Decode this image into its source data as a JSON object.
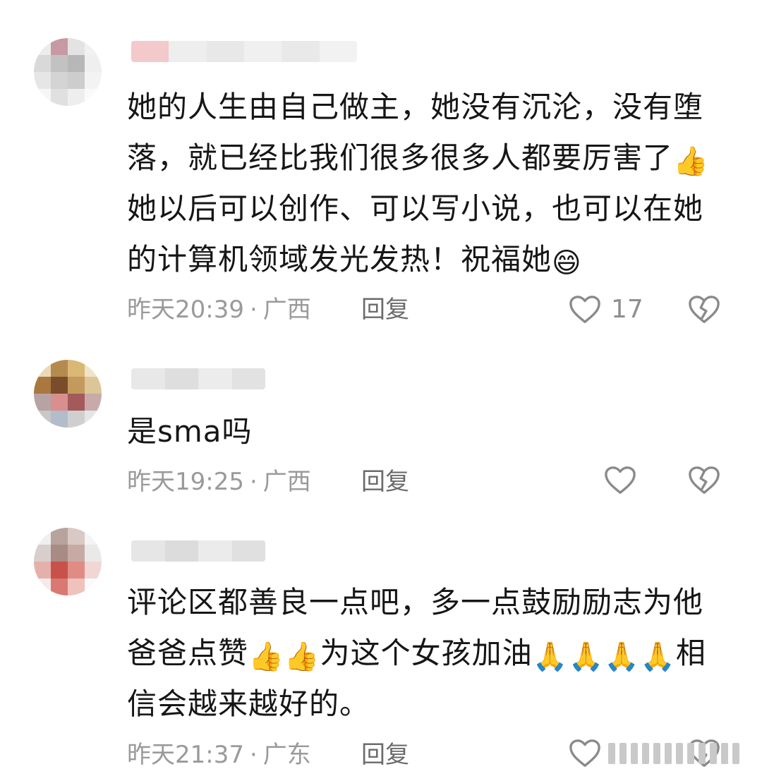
{
  "comments": [
    {
      "text_parts": [
        "她的人生由自己做主，她没有沉沦，没有堕落，就已经比我们很多很多人都要厉害了",
        "👍",
        "她以后可以创作、可以写小说，也可以在她的计算机领域发光发热！祝福她",
        "😄"
      ],
      "time": "昨天20:39",
      "location": "广西",
      "reply_label": "回复",
      "likes": "17"
    },
    {
      "text_parts": [
        "是sma吗"
      ],
      "time": "昨天19:25",
      "location": "广西",
      "reply_label": "回复",
      "likes": ""
    },
    {
      "text_parts": [
        "评论区都善良一点吧，多一点鼓励励志为他爸爸点赞",
        "👍👍",
        "为这个女孩加油",
        "🙏🙏🙏🙏",
        "相信会越来越好的。"
      ],
      "time": "昨天21:37",
      "location": "广东",
      "reply_label": "回复",
      "likes": ""
    }
  ],
  "separator": "·",
  "icons": {
    "like": "heart-outline-icon",
    "dislike": "broken-heart-icon"
  },
  "colors": {
    "text": "#161616",
    "meta": "#9a9a9a",
    "icon": "#888888"
  }
}
